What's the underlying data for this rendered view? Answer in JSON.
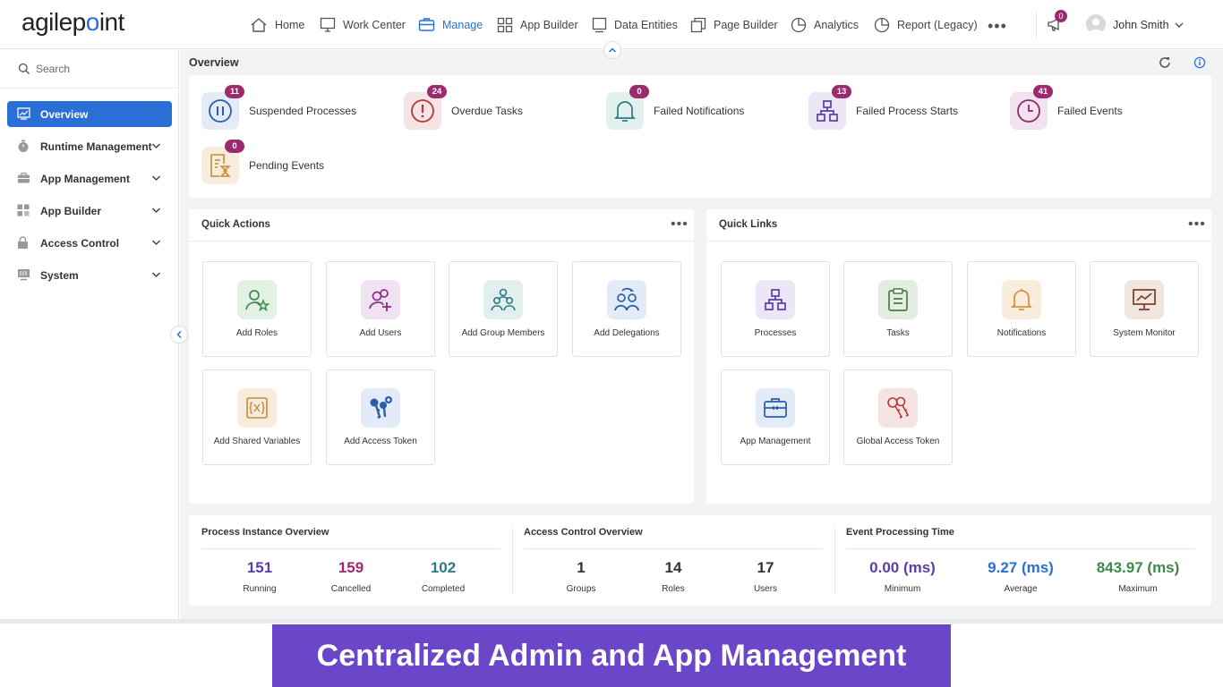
{
  "brand": {
    "logo_pre": "agilep",
    "logo_dot": "o",
    "logo_post": "int",
    "accent": "#2a6fd6",
    "badge_color": "#9b2a6e"
  },
  "nav": [
    {
      "label": "Home",
      "icon": "home-icon"
    },
    {
      "label": "Work Center",
      "icon": "monitor-icon"
    },
    {
      "label": "Manage",
      "icon": "toolbox-icon",
      "active": true
    },
    {
      "label": "App Builder",
      "icon": "grid-icon"
    },
    {
      "label": "Data Entities",
      "icon": "square-icon"
    },
    {
      "label": "Page Builder",
      "icon": "copy-icon"
    },
    {
      "label": "Analytics",
      "icon": "pie-icon"
    },
    {
      "label": "Report (Legacy)",
      "icon": "pie-icon"
    }
  ],
  "nav_more": "•••",
  "header": {
    "notifications": "0",
    "user_name": "John Smith"
  },
  "sidebar": {
    "search_placeholder": "Search",
    "items": [
      {
        "label": "Overview",
        "active": true
      },
      {
        "label": "Runtime Management"
      },
      {
        "label": "App Management"
      },
      {
        "label": "App Builder"
      },
      {
        "label": "Access Control"
      },
      {
        "label": "System"
      }
    ]
  },
  "overview": {
    "title": "Overview",
    "stats": [
      {
        "count": "11",
        "label": "Suspended Processes"
      },
      {
        "count": "24",
        "label": "Overdue Tasks"
      },
      {
        "count": "0",
        "label": "Failed Notifications"
      },
      {
        "count": "13",
        "label": "Failed Process Starts"
      },
      {
        "count": "41",
        "label": "Failed Events"
      },
      {
        "count": "0",
        "label": "Pending Events"
      }
    ]
  },
  "quick_actions": {
    "title": "Quick Actions",
    "more": "•••",
    "items": [
      "Add Roles",
      "Add Users",
      "Add Group Members",
      "Add Delegations",
      "Add Shared Variables",
      "Add Access Token"
    ]
  },
  "quick_links": {
    "title": "Quick Links",
    "more": "•••",
    "items": [
      "Processes",
      "Tasks",
      "Notifications",
      "System Monitor",
      "App Management",
      "Global Access Token"
    ]
  },
  "process_overview": {
    "title": "Process Instance Overview",
    "metrics": [
      {
        "value": "151",
        "label": "Running",
        "color": "#5a3ea8"
      },
      {
        "value": "159",
        "label": "Cancelled",
        "color": "#9b2a6e"
      },
      {
        "value": "102",
        "label": "Completed",
        "color": "#2d7a82"
      }
    ]
  },
  "access_overview": {
    "title": "Access Control Overview",
    "metrics": [
      {
        "value": "1",
        "label": "Groups"
      },
      {
        "value": "14",
        "label": "Roles"
      },
      {
        "value": "17",
        "label": "Users"
      }
    ]
  },
  "event_time": {
    "title": "Event Processing Time",
    "metrics": [
      {
        "value": "0.00 (ms)",
        "label": "Minimum",
        "color": "#5a3ea8"
      },
      {
        "value": "9.27 (ms)",
        "label": "Average",
        "color": "#2a6fd6"
      },
      {
        "value": "843.97 (ms)",
        "label": "Maximum",
        "color": "#3e8a4a"
      }
    ]
  },
  "banner": "Centralized Admin and App Management"
}
